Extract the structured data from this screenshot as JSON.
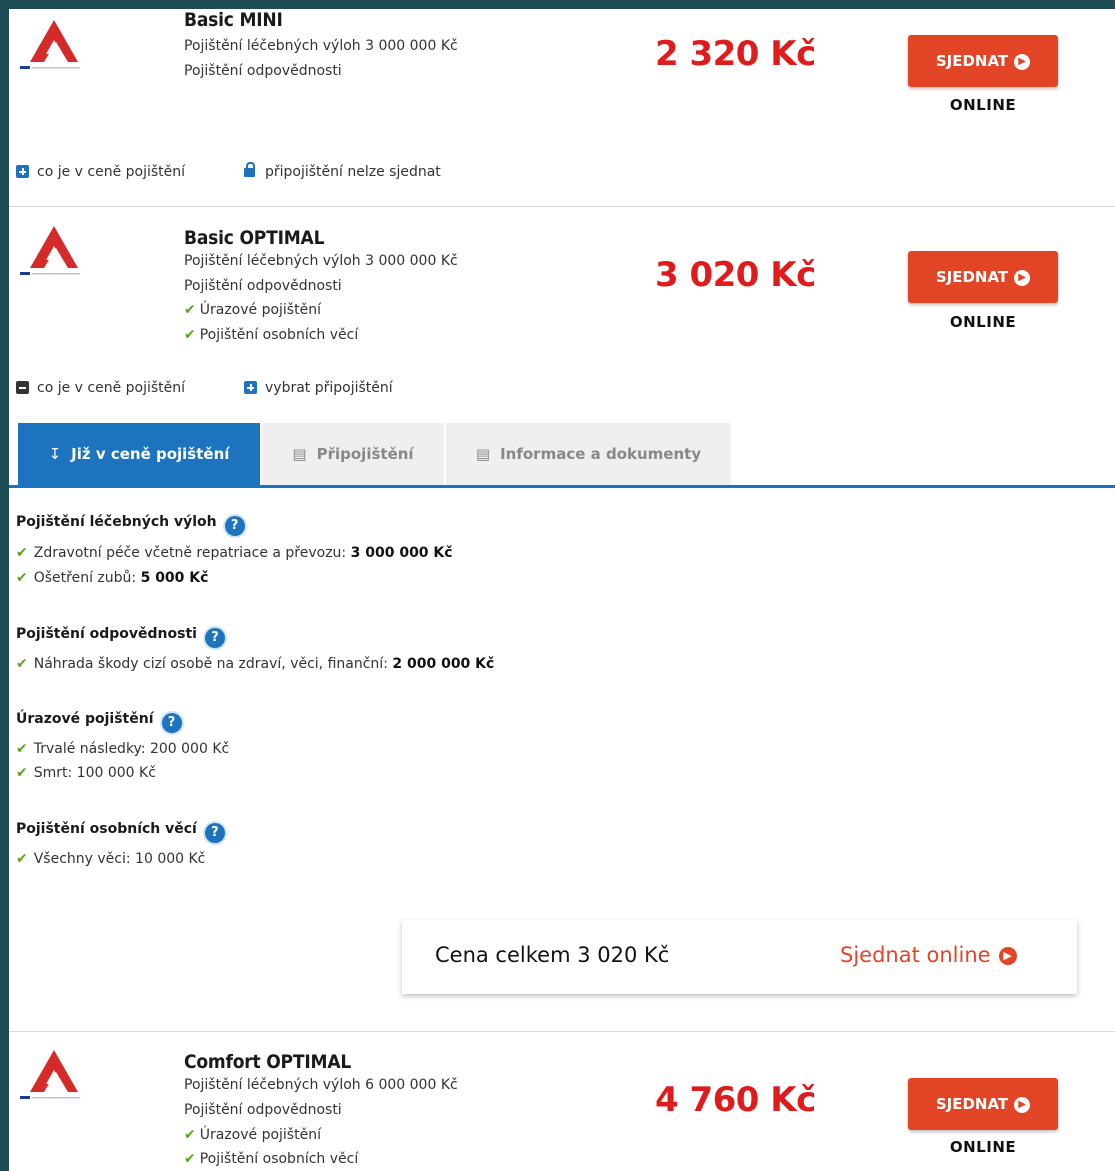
{
  "products": [
    {
      "name": "Basic MINI",
      "features": [
        "Pojištění léčebných výloh 3 000 000 Kč",
        "Pojištění odpovědnosti"
      ],
      "price": "2 320 Kč",
      "cta_label": "SJEDNAT",
      "channel": "ONLINE",
      "toggle_coverage": "co je v ceně pojištění",
      "toggle_addon": "připojištění nelze sjednat"
    },
    {
      "name": "Basic OPTIMAL",
      "features": [
        "Pojištění léčebných výloh 3 000 000 Kč",
        "Pojištění odpovědnosti"
      ],
      "checked_features": [
        "Úrazové pojištění",
        "Pojištění osobních věcí"
      ],
      "price": "3 020 Kč",
      "cta_label": "SJEDNAT",
      "channel": "ONLINE",
      "toggle_coverage": "co je v ceně pojištění",
      "toggle_addon": "vybrat připojištění"
    },
    {
      "name": "Comfort OPTIMAL",
      "features": [
        "Pojištění léčebných výloh 6 000 000 Kč",
        "Pojištění odpovědnosti"
      ],
      "checked_features": [
        "Úrazové pojištění",
        "Pojištění osobních věcí"
      ],
      "price": "4 760 Kč",
      "cta_label": "SJEDNAT",
      "channel": "ONLINE"
    }
  ],
  "tabs": [
    {
      "label": "Již v ceně pojištění",
      "icon": "arrow-down-icon",
      "active": true
    },
    {
      "label": "Připojištění",
      "icon": "cart-icon",
      "active": false
    },
    {
      "label": "Informace a dokumenty",
      "icon": "document-icon",
      "active": false
    }
  ],
  "coverage": [
    {
      "title": "Pojištění léčebných výloh",
      "items": [
        {
          "text": "Zdravotní péče včetně repatriace a převozu: ",
          "value": "3 000 000 Kč"
        },
        {
          "text": "Ošetření zubů: ",
          "value": "5 000 Kč"
        }
      ]
    },
    {
      "title": "Pojištění odpovědnosti",
      "items": [
        {
          "text": "Náhrada škody cizí osobě na zdraví, věci, finanční: ",
          "value": "2 000 000 Kč"
        }
      ]
    },
    {
      "title": "Úrazové pojištění",
      "items": [
        {
          "text": "Trvalé následky: 200 000 Kč",
          "value": ""
        },
        {
          "text": "Smrt: 100 000 Kč",
          "value": ""
        }
      ]
    },
    {
      "title": "Pojištění osobních věcí",
      "items": [
        {
          "text": "Všechny věci: 10 000 Kč",
          "value": ""
        }
      ]
    }
  ],
  "summary": {
    "total_label": "Cena celkem 3 020 Kč",
    "cta": "Sjednat online"
  },
  "help_glyph": "?",
  "colors": {
    "accent_blue": "#1e73be",
    "price_red": "#e01b1b",
    "button_orange": "#e24526",
    "check_green": "#5aa31e"
  }
}
